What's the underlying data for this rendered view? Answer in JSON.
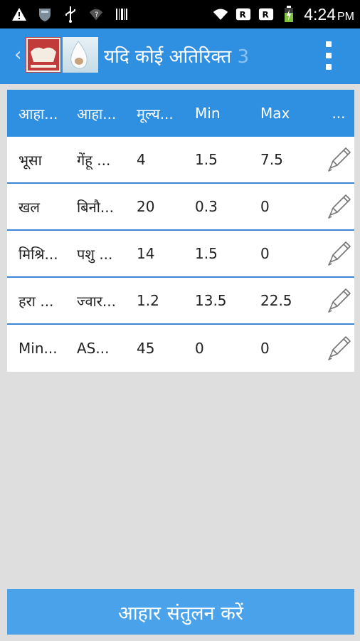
{
  "status_bar": {
    "time": "4:24",
    "ampm": "PM",
    "icons": [
      "warning-icon",
      "shield-icon",
      "usb-icon",
      "wifi-question-icon",
      "barcode-icon",
      "wifi-icon",
      "data-r-icon",
      "signal-r-icon",
      "battery-charging-icon"
    ]
  },
  "app_bar": {
    "title": "यदि कोई अतिरिक्त",
    "title_overflow": "3",
    "accent": "#2f8fe0"
  },
  "table": {
    "headers": [
      "आहा...",
      "आहा...",
      "मूल्य...",
      "Min",
      "Max",
      "..."
    ],
    "rows": [
      {
        "c1": "भूसा",
        "c2": "गेंहू ...",
        "c3": "4",
        "min": "1.5",
        "max": "7.5"
      },
      {
        "c1": "खल",
        "c2": "बिनौ...",
        "c3": "20",
        "min": "0.3",
        "max": "0"
      },
      {
        "c1": "मिश्रि...",
        "c2": "पशु ...",
        "c3": "14",
        "min": "1.5",
        "max": "0"
      },
      {
        "c1": "हरा ...",
        "c2": "ज्वार...",
        "c3": "1.2",
        "min": "13.5",
        "max": "22.5"
      },
      {
        "c1": "Min...",
        "c2": "AS...",
        "c3": "45",
        "min": "0",
        "max": "0"
      }
    ]
  },
  "bottom_button": {
    "label": "आहार संतुलन करें"
  }
}
